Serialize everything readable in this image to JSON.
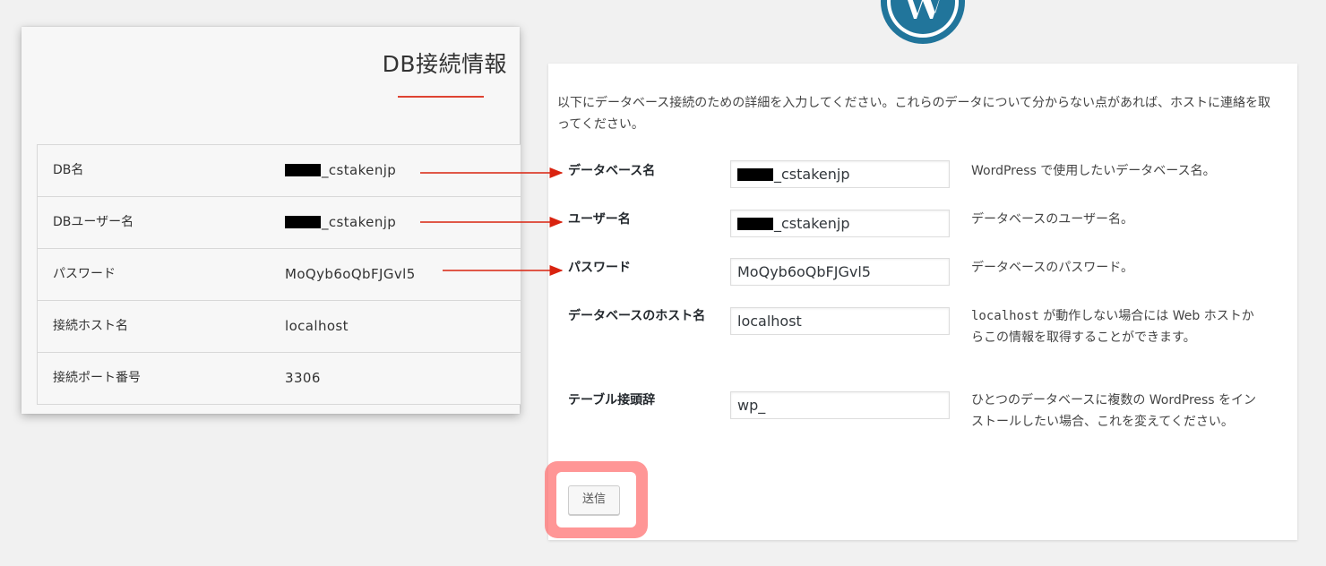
{
  "db_info_card": {
    "title": "DB接続情報",
    "rows": [
      {
        "label": "DB名",
        "value": "_cstakenjp",
        "redacted_prefix": true
      },
      {
        "label": "DBユーザー名",
        "value": "_cstakenjp",
        "redacted_prefix": true
      },
      {
        "label": "パスワード",
        "value": "MoQyb6oQbFJGvl5",
        "redacted_prefix": false
      },
      {
        "label": "接続ホスト名",
        "value": "localhost",
        "redacted_prefix": false
      },
      {
        "label": "接続ポート番号",
        "value": "3306",
        "redacted_prefix": false
      }
    ]
  },
  "wordpress_setup": {
    "intro": "以下にデータベース接続のための詳細を入力してください。これらのデータについて分からない点があれば、ホストに連絡を取ってください。",
    "fields": {
      "dbname": {
        "label": "データベース名",
        "value": "_cstakenjp",
        "description": "WordPress で使用したいデータベース名。"
      },
      "username": {
        "label": "ユーザー名",
        "value": "_cstakenjp",
        "description": "データベースのユーザー名。"
      },
      "password": {
        "label": "パスワード",
        "value": "MoQyb6oQbFJGvl5",
        "description": "データベースのパスワード。"
      },
      "host": {
        "label": "データベースのホスト名",
        "value": "localhost",
        "description_code": "localhost",
        "description_rest": " が動作しない場合には Web ホストからこの情報を取得することができます。"
      },
      "prefix": {
        "label": "テーブル接頭辞",
        "value": "wp_",
        "description": "ひとつのデータベースに複数の WordPress をインストールしたい場合、これを変えてください。"
      }
    },
    "submit_label": "送信"
  },
  "colors": {
    "arrow": "#d9230f",
    "wordpress_blue": "#21759b",
    "highlight": "#ff6e6e"
  },
  "icons": {
    "logo": "wordpress-logo-icon"
  }
}
